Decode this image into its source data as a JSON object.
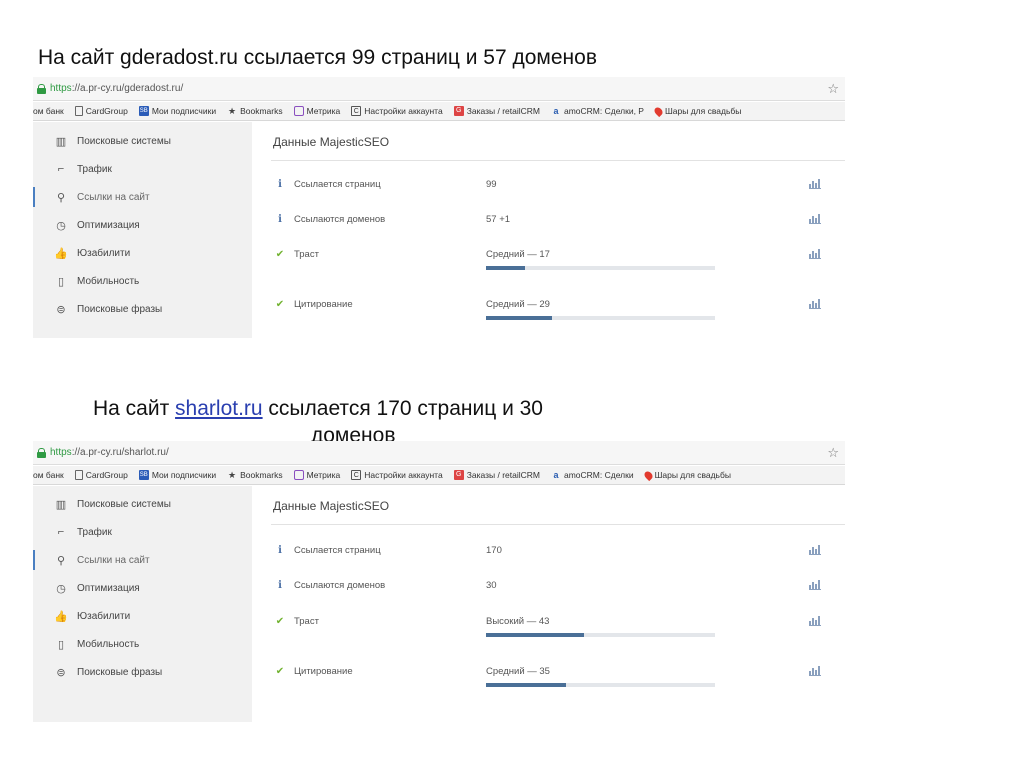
{
  "captions": [
    {
      "text": "На сайт gderadost.ru ссылается 99 страниц и 57 доменов"
    },
    {
      "prefix": "На сайт ",
      "link": "sharlot.ru",
      "suffix": " ссылается 170 страниц и 30",
      "line2": "доменов"
    }
  ],
  "shots": [
    {
      "url_scheme": "https",
      "url_rest": "://a.pr-cy.ru/gderadost.ru/",
      "bookmarks": [
        {
          "label": "ом банк",
          "icon": "none"
        },
        {
          "label": "CardGroup",
          "icon": "doc-icon"
        },
        {
          "label": "Мои подписчики",
          "icon": "sb-icon"
        },
        {
          "label": "Bookmarks",
          "icon": "star-icon"
        },
        {
          "label": "Метрика",
          "icon": "metrika-icon"
        },
        {
          "label": "Настройки аккаунта",
          "icon": "c-icon"
        },
        {
          "label": "Заказы / retailCRM",
          "icon": "g-icon"
        },
        {
          "label": "amoCRM: Сделки, Р",
          "icon": "amo-icon"
        },
        {
          "label": "Шары для свадьбы",
          "icon": "pin-icon"
        }
      ],
      "sidebar": [
        {
          "label": "Поисковые системы",
          "icon": "search-systems-icon"
        },
        {
          "label": "Трафик",
          "icon": "traffic-chart-icon"
        },
        {
          "label": "Ссылки на сайт",
          "icon": "link-icon",
          "active": true
        },
        {
          "label": "Оптимизация",
          "icon": "optimization-icon"
        },
        {
          "label": "Юзабилити",
          "icon": "thumbs-up-icon"
        },
        {
          "label": "Мобильность",
          "icon": "mobile-icon"
        },
        {
          "label": "Поисковые фразы",
          "icon": "search-phrases-icon"
        }
      ],
      "panel_title": "Данные MajesticSEO",
      "rows": [
        {
          "icon": "info",
          "label": "Ссылается страниц",
          "value": "99"
        },
        {
          "icon": "info",
          "label": "Ссылаются доменов",
          "value": "57 +1"
        },
        {
          "icon": "check",
          "label": "Траст",
          "value": "Средний — 17",
          "bar": 0.17
        },
        {
          "icon": "check",
          "label": "Цитирование",
          "value": "Средний — 29",
          "bar": 0.29
        }
      ]
    },
    {
      "url_scheme": "https",
      "url_rest": "://a.pr-cy.ru/sharlot.ru/",
      "bookmarks": [
        {
          "label": "ом банк",
          "icon": "none"
        },
        {
          "label": "CardGroup",
          "icon": "doc-icon"
        },
        {
          "label": "Мои подписчики",
          "icon": "sb-icon"
        },
        {
          "label": "Bookmarks",
          "icon": "star-icon"
        },
        {
          "label": "Метрика",
          "icon": "metrika-icon"
        },
        {
          "label": "Настройки аккаунта",
          "icon": "c-icon"
        },
        {
          "label": "Заказы / retailCRM",
          "icon": "g-icon"
        },
        {
          "label": "amoCRM: Сделки",
          "icon": "amo-icon"
        },
        {
          "label": "Шары для свадьбы",
          "icon": "pin-icon"
        }
      ],
      "sidebar": [
        {
          "label": "Поисковые системы",
          "icon": "search-systems-icon"
        },
        {
          "label": "Трафик",
          "icon": "traffic-chart-icon"
        },
        {
          "label": "Ссылки на сайт",
          "icon": "link-icon",
          "active": true
        },
        {
          "label": "Оптимизация",
          "icon": "optimization-icon"
        },
        {
          "label": "Юзабилити",
          "icon": "thumbs-up-icon"
        },
        {
          "label": "Мобильность",
          "icon": "mobile-icon"
        },
        {
          "label": "Поисковые фразы",
          "icon": "search-phrases-icon"
        }
      ],
      "panel_title": "Данные MajesticSEO",
      "rows": [
        {
          "icon": "info",
          "label": "Ссылается страниц",
          "value": "170"
        },
        {
          "icon": "info",
          "label": "Ссылаются доменов",
          "value": "30"
        },
        {
          "icon": "check",
          "label": "Траст",
          "value": "Высокий — 43",
          "bar": 0.43
        },
        {
          "icon": "check",
          "label": "Цитирование",
          "value": "Средний — 35",
          "bar": 0.35
        }
      ]
    }
  ],
  "colors": {
    "bar_fill": "#4a6f97",
    "check": "#72b331",
    "info": "#4a6fa5",
    "url_green": "#2f9a43"
  }
}
